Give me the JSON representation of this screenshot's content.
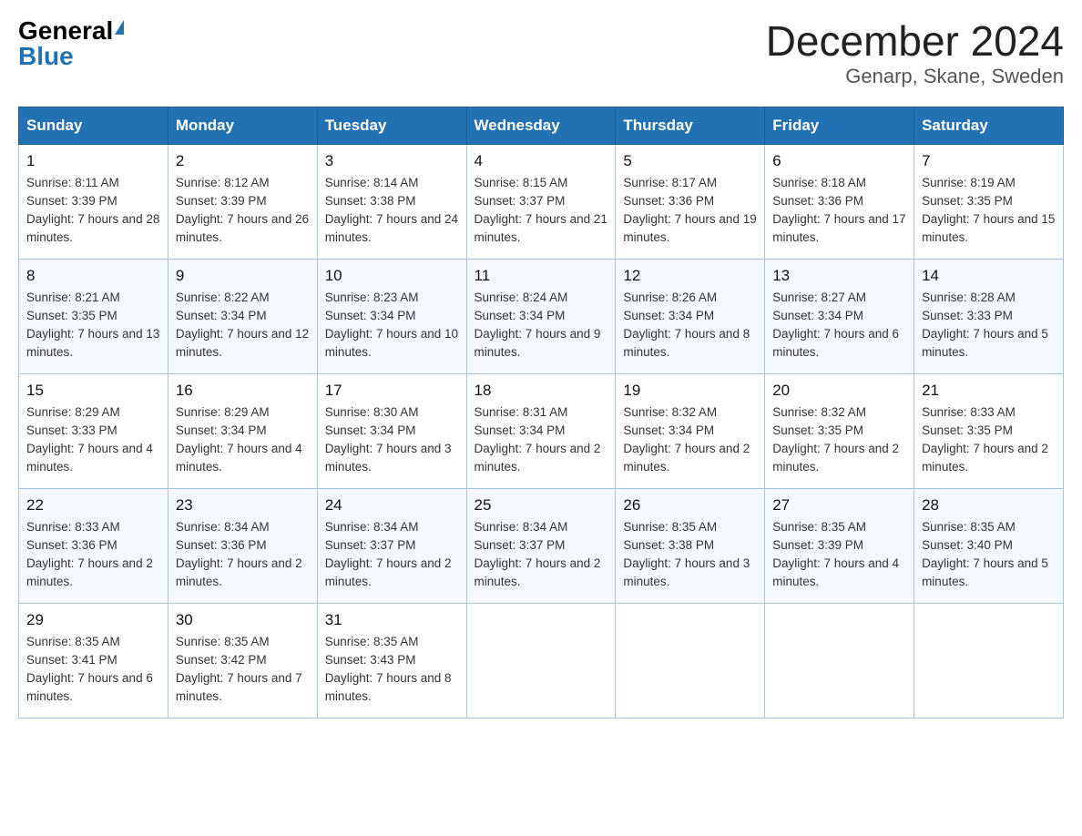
{
  "logo": {
    "general": "General",
    "blue": "Blue"
  },
  "title": "December 2024",
  "location": "Genarp, Skane, Sweden",
  "weekdays": [
    "Sunday",
    "Monday",
    "Tuesday",
    "Wednesday",
    "Thursday",
    "Friday",
    "Saturday"
  ],
  "weeks": [
    [
      {
        "day": "1",
        "sunrise": "8:11 AM",
        "sunset": "3:39 PM",
        "daylight": "7 hours and 28 minutes."
      },
      {
        "day": "2",
        "sunrise": "8:12 AM",
        "sunset": "3:39 PM",
        "daylight": "7 hours and 26 minutes."
      },
      {
        "day": "3",
        "sunrise": "8:14 AM",
        "sunset": "3:38 PM",
        "daylight": "7 hours and 24 minutes."
      },
      {
        "day": "4",
        "sunrise": "8:15 AM",
        "sunset": "3:37 PM",
        "daylight": "7 hours and 21 minutes."
      },
      {
        "day": "5",
        "sunrise": "8:17 AM",
        "sunset": "3:36 PM",
        "daylight": "7 hours and 19 minutes."
      },
      {
        "day": "6",
        "sunrise": "8:18 AM",
        "sunset": "3:36 PM",
        "daylight": "7 hours and 17 minutes."
      },
      {
        "day": "7",
        "sunrise": "8:19 AM",
        "sunset": "3:35 PM",
        "daylight": "7 hours and 15 minutes."
      }
    ],
    [
      {
        "day": "8",
        "sunrise": "8:21 AM",
        "sunset": "3:35 PM",
        "daylight": "7 hours and 13 minutes."
      },
      {
        "day": "9",
        "sunrise": "8:22 AM",
        "sunset": "3:34 PM",
        "daylight": "7 hours and 12 minutes."
      },
      {
        "day": "10",
        "sunrise": "8:23 AM",
        "sunset": "3:34 PM",
        "daylight": "7 hours and 10 minutes."
      },
      {
        "day": "11",
        "sunrise": "8:24 AM",
        "sunset": "3:34 PM",
        "daylight": "7 hours and 9 minutes."
      },
      {
        "day": "12",
        "sunrise": "8:26 AM",
        "sunset": "3:34 PM",
        "daylight": "7 hours and 8 minutes."
      },
      {
        "day": "13",
        "sunrise": "8:27 AM",
        "sunset": "3:34 PM",
        "daylight": "7 hours and 6 minutes."
      },
      {
        "day": "14",
        "sunrise": "8:28 AM",
        "sunset": "3:33 PM",
        "daylight": "7 hours and 5 minutes."
      }
    ],
    [
      {
        "day": "15",
        "sunrise": "8:29 AM",
        "sunset": "3:33 PM",
        "daylight": "7 hours and 4 minutes."
      },
      {
        "day": "16",
        "sunrise": "8:29 AM",
        "sunset": "3:34 PM",
        "daylight": "7 hours and 4 minutes."
      },
      {
        "day": "17",
        "sunrise": "8:30 AM",
        "sunset": "3:34 PM",
        "daylight": "7 hours and 3 minutes."
      },
      {
        "day": "18",
        "sunrise": "8:31 AM",
        "sunset": "3:34 PM",
        "daylight": "7 hours and 2 minutes."
      },
      {
        "day": "19",
        "sunrise": "8:32 AM",
        "sunset": "3:34 PM",
        "daylight": "7 hours and 2 minutes."
      },
      {
        "day": "20",
        "sunrise": "8:32 AM",
        "sunset": "3:35 PM",
        "daylight": "7 hours and 2 minutes."
      },
      {
        "day": "21",
        "sunrise": "8:33 AM",
        "sunset": "3:35 PM",
        "daylight": "7 hours and 2 minutes."
      }
    ],
    [
      {
        "day": "22",
        "sunrise": "8:33 AM",
        "sunset": "3:36 PM",
        "daylight": "7 hours and 2 minutes."
      },
      {
        "day": "23",
        "sunrise": "8:34 AM",
        "sunset": "3:36 PM",
        "daylight": "7 hours and 2 minutes."
      },
      {
        "day": "24",
        "sunrise": "8:34 AM",
        "sunset": "3:37 PM",
        "daylight": "7 hours and 2 minutes."
      },
      {
        "day": "25",
        "sunrise": "8:34 AM",
        "sunset": "3:37 PM",
        "daylight": "7 hours and 2 minutes."
      },
      {
        "day": "26",
        "sunrise": "8:35 AM",
        "sunset": "3:38 PM",
        "daylight": "7 hours and 3 minutes."
      },
      {
        "day": "27",
        "sunrise": "8:35 AM",
        "sunset": "3:39 PM",
        "daylight": "7 hours and 4 minutes."
      },
      {
        "day": "28",
        "sunrise": "8:35 AM",
        "sunset": "3:40 PM",
        "daylight": "7 hours and 5 minutes."
      }
    ],
    [
      {
        "day": "29",
        "sunrise": "8:35 AM",
        "sunset": "3:41 PM",
        "daylight": "7 hours and 6 minutes."
      },
      {
        "day": "30",
        "sunrise": "8:35 AM",
        "sunset": "3:42 PM",
        "daylight": "7 hours and 7 minutes."
      },
      {
        "day": "31",
        "sunrise": "8:35 AM",
        "sunset": "3:43 PM",
        "daylight": "7 hours and 8 minutes."
      },
      null,
      null,
      null,
      null
    ]
  ]
}
